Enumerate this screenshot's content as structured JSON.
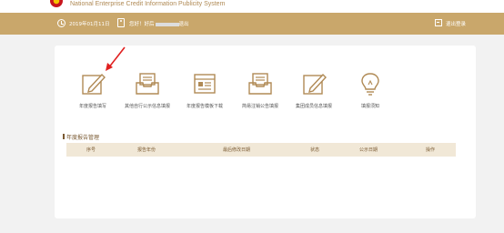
{
  "header": {
    "subtitle": "National Enterprise Credit Information Publicity System"
  },
  "topbar": {
    "date": "2019年01月11日",
    "welcome": "您好！好后",
    "welcome_tail": "退出",
    "logout": "退出登录"
  },
  "tiles": [
    {
      "label": "年度报告填写",
      "icon": "pencil-edit-icon"
    },
    {
      "label": "其他自行公示信息填报",
      "icon": "inbox-tray-icon"
    },
    {
      "label": "年度报告模板下载",
      "icon": "browser-window-icon"
    },
    {
      "label": "简易注销公告填报",
      "icon": "inbox-tray-icon"
    },
    {
      "label": "集团成员信息填报",
      "icon": "pencil-edit-icon"
    },
    {
      "label": "填报须知",
      "icon": "lightbulb-icon"
    }
  ],
  "annual_report": {
    "section_title": "年度报告管理",
    "columns": [
      "序号",
      "报告年份",
      "最后修改日期",
      "状态",
      "公示日期",
      "操作"
    ]
  },
  "colors": {
    "accent": "#c9a76b",
    "icon": "#b08a55",
    "header_row": "#f1e8d7",
    "arrow": "#e02020"
  }
}
